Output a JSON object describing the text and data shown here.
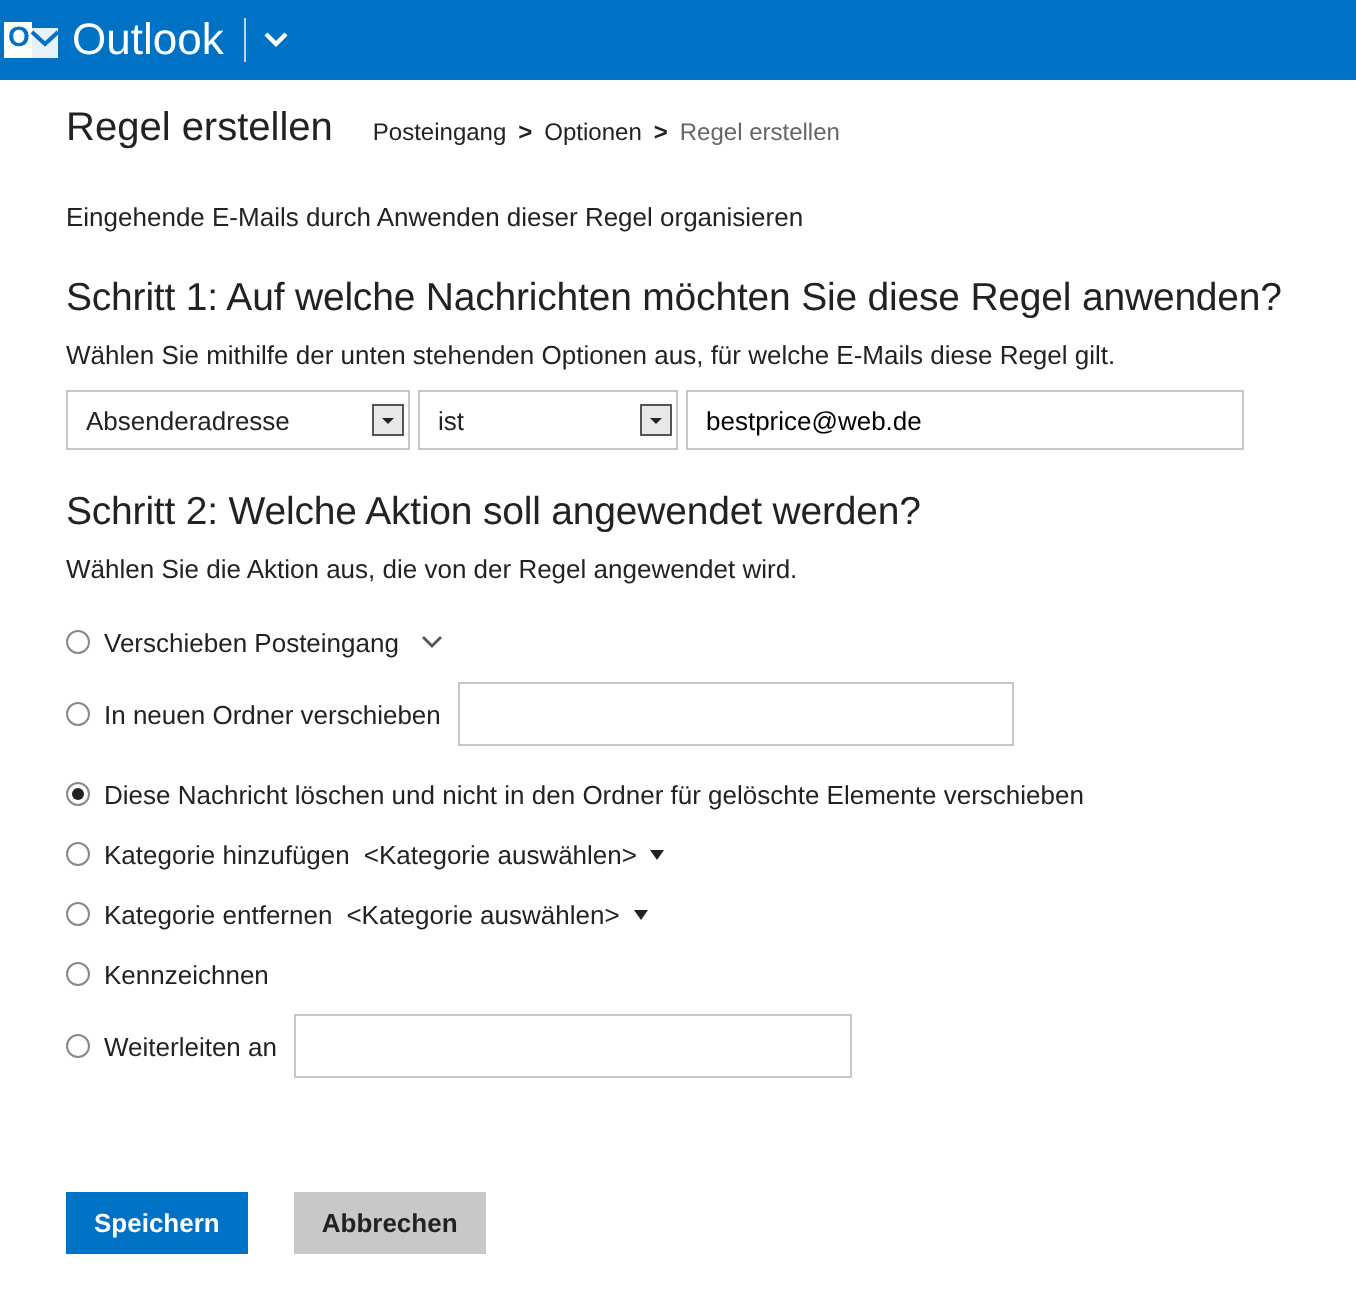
{
  "header": {
    "logo_letter": "O",
    "app_name": "Outlook"
  },
  "page": {
    "title": "Regel erstellen",
    "breadcrumb": [
      {
        "label": "Posteingang",
        "current": false
      },
      {
        "label": "Optionen",
        "current": false
      },
      {
        "label": "Regel erstellen",
        "current": true
      }
    ],
    "separator": ">"
  },
  "intro": "Eingehende E-Mails durch Anwenden dieser Regel organisieren",
  "step1": {
    "heading": "Schritt 1: Auf welche Nachrichten möchten Sie diese Regel anwenden?",
    "hint": "Wählen Sie mithilfe der unten stehenden Optionen aus, für welche E-Mails diese Regel gilt.",
    "condition_field": "Absenderadresse",
    "operator": "ist",
    "value": "bestprice@web.de"
  },
  "step2": {
    "heading": "Schritt 2: Welche Aktion soll angewendet werden?",
    "hint": "Wählen Sie die Aktion aus, die von der Regel angewendet wird.",
    "actions": [
      {
        "kind": "dropdown",
        "label": "Verschieben Posteingang",
        "selected": false
      },
      {
        "kind": "textbox",
        "label": "In neuen Ordner verschieben",
        "selected": false
      },
      {
        "kind": "plain",
        "label": "Diese Nachricht löschen und nicht in den Ordner für gelöschte Elemente verschieben",
        "selected": true
      },
      {
        "kind": "picker",
        "label": "Kategorie hinzufügen",
        "picker": "<Kategorie auswählen>",
        "selected": false
      },
      {
        "kind": "picker",
        "label": "Kategorie entfernen",
        "picker": "<Kategorie auswählen>",
        "selected": false
      },
      {
        "kind": "plain",
        "label": "Kennzeichnen",
        "selected": false
      },
      {
        "kind": "textbox",
        "label": "Weiterleiten an",
        "selected": false
      }
    ]
  },
  "buttons": [
    {
      "kind": "primary",
      "label": "Speichern"
    },
    {
      "kind": "secondary",
      "label": "Abbrechen"
    }
  ]
}
